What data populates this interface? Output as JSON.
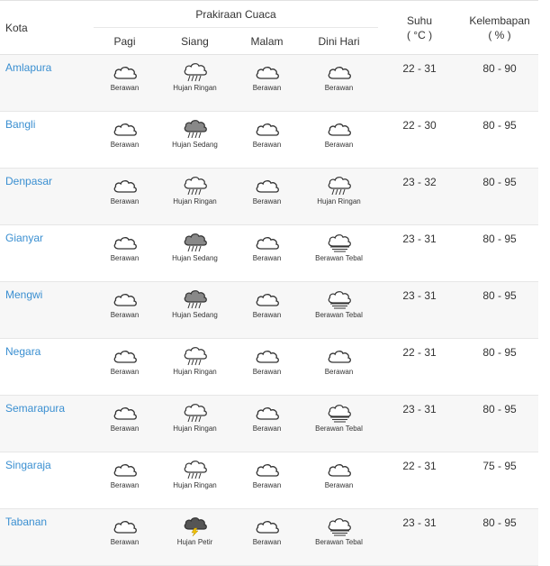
{
  "header": {
    "kota": "Kota",
    "prakiraan": "Prakiraan Cuaca",
    "periods": [
      "Pagi",
      "Siang",
      "Malam",
      "Dini Hari"
    ],
    "suhu_line1": "Suhu",
    "suhu_line2": "( °C )",
    "kelembapan_line1": "Kelembapan",
    "kelembapan_line2": "( % )"
  },
  "rows": [
    {
      "city": "Amlapura",
      "forecast": [
        {
          "label": "Berawan",
          "icon": "cloud-icon"
        },
        {
          "label": "Hujan Ringan",
          "icon": "light-rain-icon"
        },
        {
          "label": "Berawan",
          "icon": "cloud-icon"
        },
        {
          "label": "Berawan",
          "icon": "cloud-icon"
        }
      ],
      "suhu": "22 - 31",
      "kelembapan": "80 - 90"
    },
    {
      "city": "Bangli",
      "forecast": [
        {
          "label": "Berawan",
          "icon": "cloud-icon"
        },
        {
          "label": "Hujan Sedang",
          "icon": "moderate-rain-icon"
        },
        {
          "label": "Berawan",
          "icon": "cloud-icon"
        },
        {
          "label": "Berawan",
          "icon": "cloud-icon"
        }
      ],
      "suhu": "22 - 30",
      "kelembapan": "80 - 95"
    },
    {
      "city": "Denpasar",
      "forecast": [
        {
          "label": "Berawan",
          "icon": "cloud-icon"
        },
        {
          "label": "Hujan Ringan",
          "icon": "light-rain-icon"
        },
        {
          "label": "Berawan",
          "icon": "cloud-icon"
        },
        {
          "label": "Hujan Ringan",
          "icon": "light-rain-icon"
        }
      ],
      "suhu": "23 - 32",
      "kelembapan": "80 - 95"
    },
    {
      "city": "Gianyar",
      "forecast": [
        {
          "label": "Berawan",
          "icon": "cloud-icon"
        },
        {
          "label": "Hujan Sedang",
          "icon": "moderate-rain-icon"
        },
        {
          "label": "Berawan",
          "icon": "cloud-icon"
        },
        {
          "label": "Berawan Tebal",
          "icon": "overcast-icon"
        }
      ],
      "suhu": "23 - 31",
      "kelembapan": "80 - 95"
    },
    {
      "city": "Mengwi",
      "forecast": [
        {
          "label": "Berawan",
          "icon": "cloud-icon"
        },
        {
          "label": "Hujan Sedang",
          "icon": "moderate-rain-icon"
        },
        {
          "label": "Berawan",
          "icon": "cloud-icon"
        },
        {
          "label": "Berawan Tebal",
          "icon": "overcast-icon"
        }
      ],
      "suhu": "23 - 31",
      "kelembapan": "80 - 95"
    },
    {
      "city": "Negara",
      "forecast": [
        {
          "label": "Berawan",
          "icon": "cloud-icon"
        },
        {
          "label": "Hujan Ringan",
          "icon": "light-rain-icon"
        },
        {
          "label": "Berawan",
          "icon": "cloud-icon"
        },
        {
          "label": "Berawan",
          "icon": "cloud-icon"
        }
      ],
      "suhu": "22 - 31",
      "kelembapan": "80 - 95"
    },
    {
      "city": "Semarapura",
      "forecast": [
        {
          "label": "Berawan",
          "icon": "cloud-icon"
        },
        {
          "label": "Hujan Ringan",
          "icon": "light-rain-icon"
        },
        {
          "label": "Berawan",
          "icon": "cloud-icon"
        },
        {
          "label": "Berawan Tebal",
          "icon": "overcast-icon"
        }
      ],
      "suhu": "23 - 31",
      "kelembapan": "80 - 95"
    },
    {
      "city": "Singaraja",
      "forecast": [
        {
          "label": "Berawan",
          "icon": "cloud-icon"
        },
        {
          "label": "Hujan Ringan",
          "icon": "light-rain-icon"
        },
        {
          "label": "Berawan",
          "icon": "cloud-icon"
        },
        {
          "label": "Berawan",
          "icon": "cloud-icon"
        }
      ],
      "suhu": "22 - 31",
      "kelembapan": "75 - 95"
    },
    {
      "city": "Tabanan",
      "forecast": [
        {
          "label": "Berawan",
          "icon": "cloud-icon"
        },
        {
          "label": "Hujan Petir",
          "icon": "thunderstorm-icon"
        },
        {
          "label": "Berawan",
          "icon": "cloud-icon"
        },
        {
          "label": "Berawan Tebal",
          "icon": "overcast-icon"
        }
      ],
      "suhu": "23 - 31",
      "kelembapan": "80 - 95"
    }
  ],
  "colors": {
    "link": "#3a8fd1",
    "stripe": "#f7f7f7",
    "border": "#e2e2e2",
    "bolt": "#f2c200"
  }
}
